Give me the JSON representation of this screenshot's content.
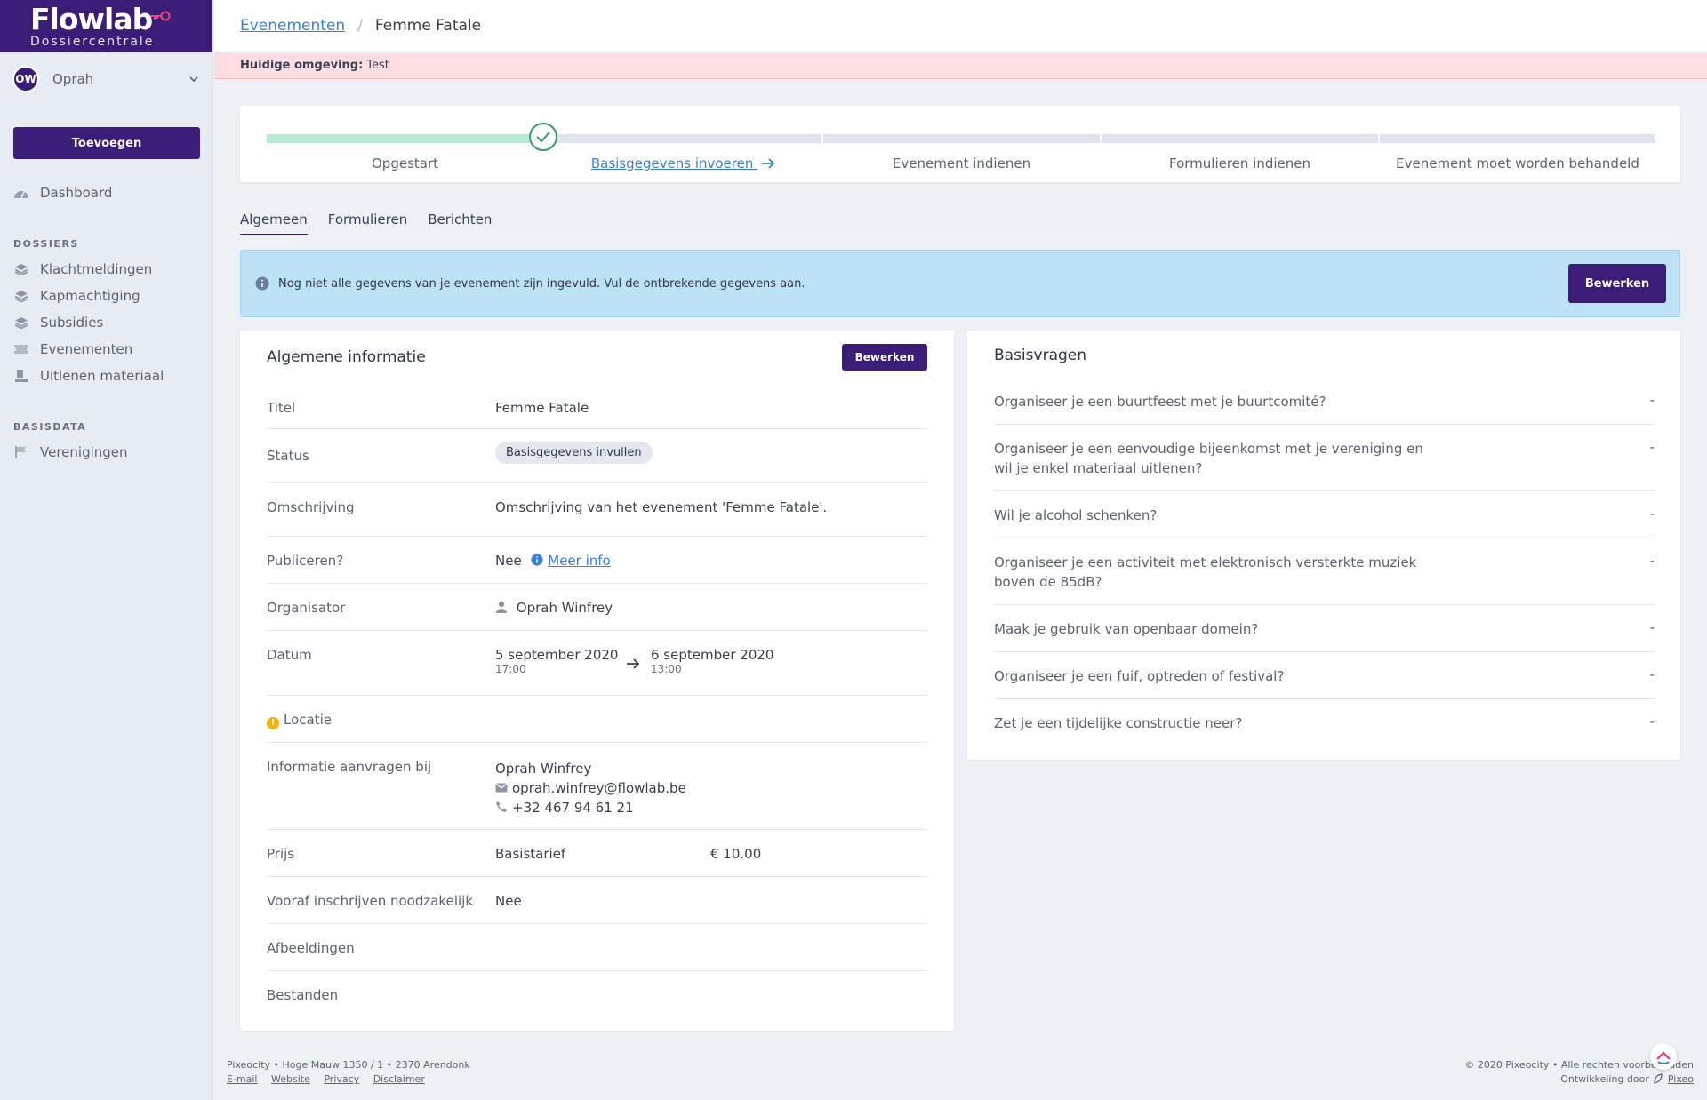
{
  "brand": {
    "name": "Flowlab",
    "subtitle": "Dossiercentrale"
  },
  "user": {
    "initials": "OW",
    "name": "Oprah"
  },
  "sidebar": {
    "add_label": "Toevoegen",
    "dashboard": "Dashboard",
    "section_dossiers": "DOSSIERS",
    "dossiers": [
      "Klachtmeldingen",
      "Kapmachtiging",
      "Subsidies",
      "Evenementen",
      "Uitlenen materiaal"
    ],
    "section_basisdata": "BASISDATA",
    "basisdata": [
      "Verenigingen"
    ]
  },
  "breadcrumb": {
    "parent": "Evenementen",
    "separator": "/",
    "current": "Femme Fatale"
  },
  "environment": {
    "label": "Huidige omgeving:",
    "value": "Test"
  },
  "steps": [
    "Opgestart",
    "Basisgegevens invoeren",
    "Evenement indienen",
    "Formulieren indienen",
    "Evenement moet worden behandeld"
  ],
  "tabs": [
    "Algemeen",
    "Formulieren",
    "Berichten"
  ],
  "alert": {
    "text": "Nog niet alle gegevens van je evenement zijn ingevuld. Vul de ontbrekende gegevens aan.",
    "button": "Bewerken"
  },
  "info": {
    "title": "Algemene informatie",
    "edit_label": "Bewerken",
    "labels": {
      "titel": "Titel",
      "status": "Status",
      "omschrijving": "Omschrijving",
      "publiceren": "Publiceren?",
      "organisator": "Organisator",
      "datum": "Datum",
      "locatie": "Locatie",
      "informatie": "Informatie aanvragen bij",
      "prijs": "Prijs",
      "vooraf": "Vooraf inschrijven noodzakelijk",
      "afbeeldingen": "Afbeeldingen",
      "bestanden": "Bestanden"
    },
    "titel": "Femme Fatale",
    "status": "Basisgegevens invullen",
    "omschrijving": "Omschrijving van het evenement 'Femme Fatale'.",
    "publiceren": "Nee",
    "meer_info": "Meer info",
    "organisator": "Oprah Winfrey",
    "start_date": "5 september 2020",
    "start_time": "17:00",
    "end_date": "6 september 2020",
    "end_time": "13:00",
    "contact_name": "Oprah Winfrey",
    "contact_email": "oprah.winfrey@flowlab.be",
    "contact_phone": "+32 467 94 61 21",
    "prijs_type": "Basistarief",
    "prijs_bedrag": "€ 10.00",
    "vooraf": "Nee"
  },
  "qa": {
    "title": "Basisvragen",
    "items": [
      {
        "q": "Organiseer je een buurtfeest met je buurtcomité?",
        "a": "-"
      },
      {
        "q": "Organiseer je een eenvoudige bijeenkomst met je vereniging en wil je enkel materiaal uitlenen?",
        "a": "-"
      },
      {
        "q": "Wil je alcohol schenken?",
        "a": "-"
      },
      {
        "q": "Organiseer je een activiteit met elektronisch versterkte muziek boven de 85dB?",
        "a": "-"
      },
      {
        "q": "Maak je gebruik van openbaar domein?",
        "a": "-"
      },
      {
        "q": "Organiseer je een fuif, optreden of festival?",
        "a": "-"
      },
      {
        "q": "Zet je een tijdelijke constructie neer?",
        "a": "-"
      }
    ]
  },
  "footer": {
    "address": "Pixeocity • Hoge Mauw 1350 / 1 • 2370 Arendonk",
    "links": [
      "E-mail",
      "Website",
      "Privacy",
      "Disclaimer"
    ],
    "copyright": "© 2020 Pixeocity • Alle rechten voorbehouden",
    "dev_label": "Ontwikkeling door",
    "dev_name": "Pixeo"
  },
  "colors": {
    "primary": "#3b1d78",
    "link": "#3b7fd6",
    "alert_bg": "#bde2f5",
    "env_bg": "#fbdde2",
    "progress_done": "#b8ebcf"
  }
}
